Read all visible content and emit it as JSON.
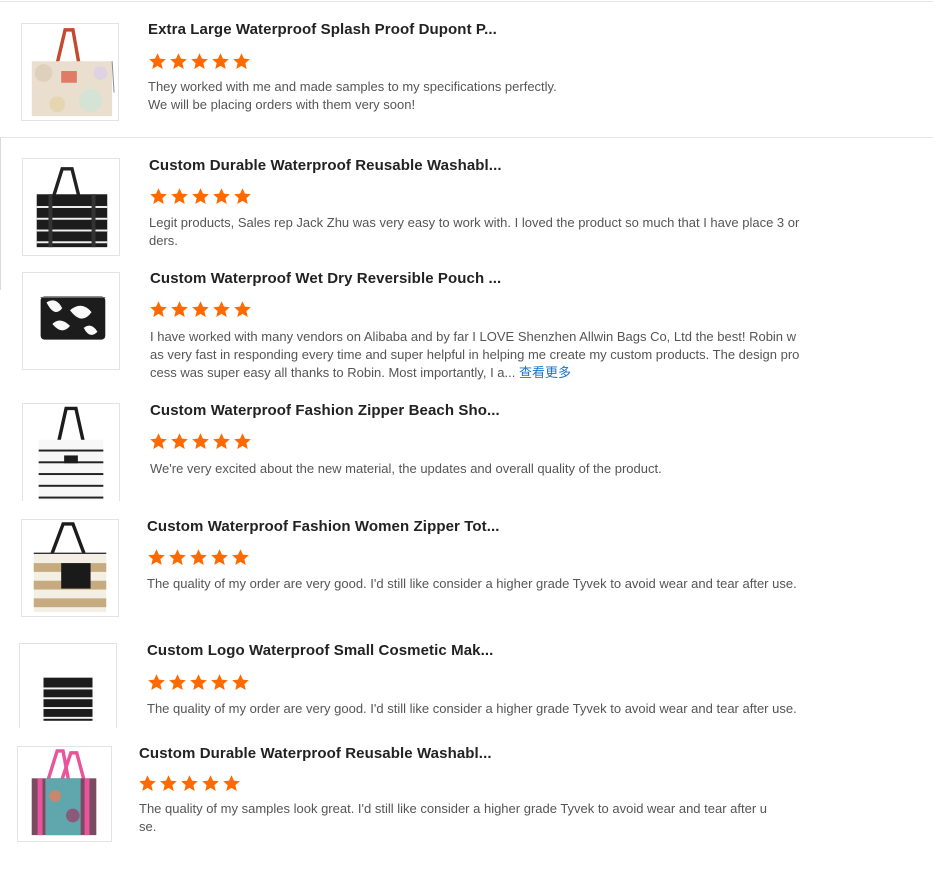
{
  "colors": {
    "star": "#ff6a00",
    "more_link": "#1a73c9"
  },
  "reviews": [
    {
      "title": "Extra Large Waterproof Splash Proof Dupont P...",
      "rating": 5,
      "text": "They worked with me and made samples to my specifications perfectly.\nWe will be placing orders with them very soon!",
      "more": "",
      "image": "beige-floral-tote-bag"
    },
    {
      "title": "Custom Durable Waterproof Reusable Washabl...",
      "rating": 5,
      "text": "Legit products, Sales rep Jack Zhu was very easy to work with.  I loved the product so much that I have place 3 orders.",
      "more": "",
      "image": "black-striped-tote-bag"
    },
    {
      "title": "Custom Waterproof Wet Dry Reversible Pouch ...",
      "rating": 5,
      "text": "I have worked with many vendors on Alibaba and by far I LOVE Shenzhen Allwin Bags Co, Ltd the best! Robin was very fast in responding every time and super helpful in helping me create my custom products. The design process was super easy all thanks to Robin. Most importantly, I a... ",
      "more": "查看更多",
      "image": "leaf-print-pouch"
    },
    {
      "title": "Custom Waterproof Fashion Zipper Beach Sho...",
      "rating": 5,
      "text": "We're very excited about the new material, the updates and overall quality of the product.",
      "more": "",
      "image": "white-striped-tote-bag"
    },
    {
      "title": "Custom Waterproof Fashion Women Zipper Tot...",
      "rating": 5,
      "text": "The quality of my order are very good. I'd still like consider a higher grade Tyvek to avoid wear and tear after use.",
      "more": "",
      "image": "tan-striped-tote-bag"
    },
    {
      "title": "Custom Logo Waterproof Small Cosmetic Mak...",
      "rating": 5,
      "text": "The quality of my order are very good. I'd still like consider a higher grade Tyvek to avoid wear and tear after use.",
      "more": "",
      "image": "black-striped-cosmetic-pouch"
    },
    {
      "title": "Custom Durable Waterproof Reusable Washabl...",
      "rating": 5,
      "text": "The quality of my samples look great. I'd still like consider a higher grade Tyvek to avoid wear and tear after use.",
      "more": "",
      "image": "pink-patterned-tote-bag"
    }
  ]
}
